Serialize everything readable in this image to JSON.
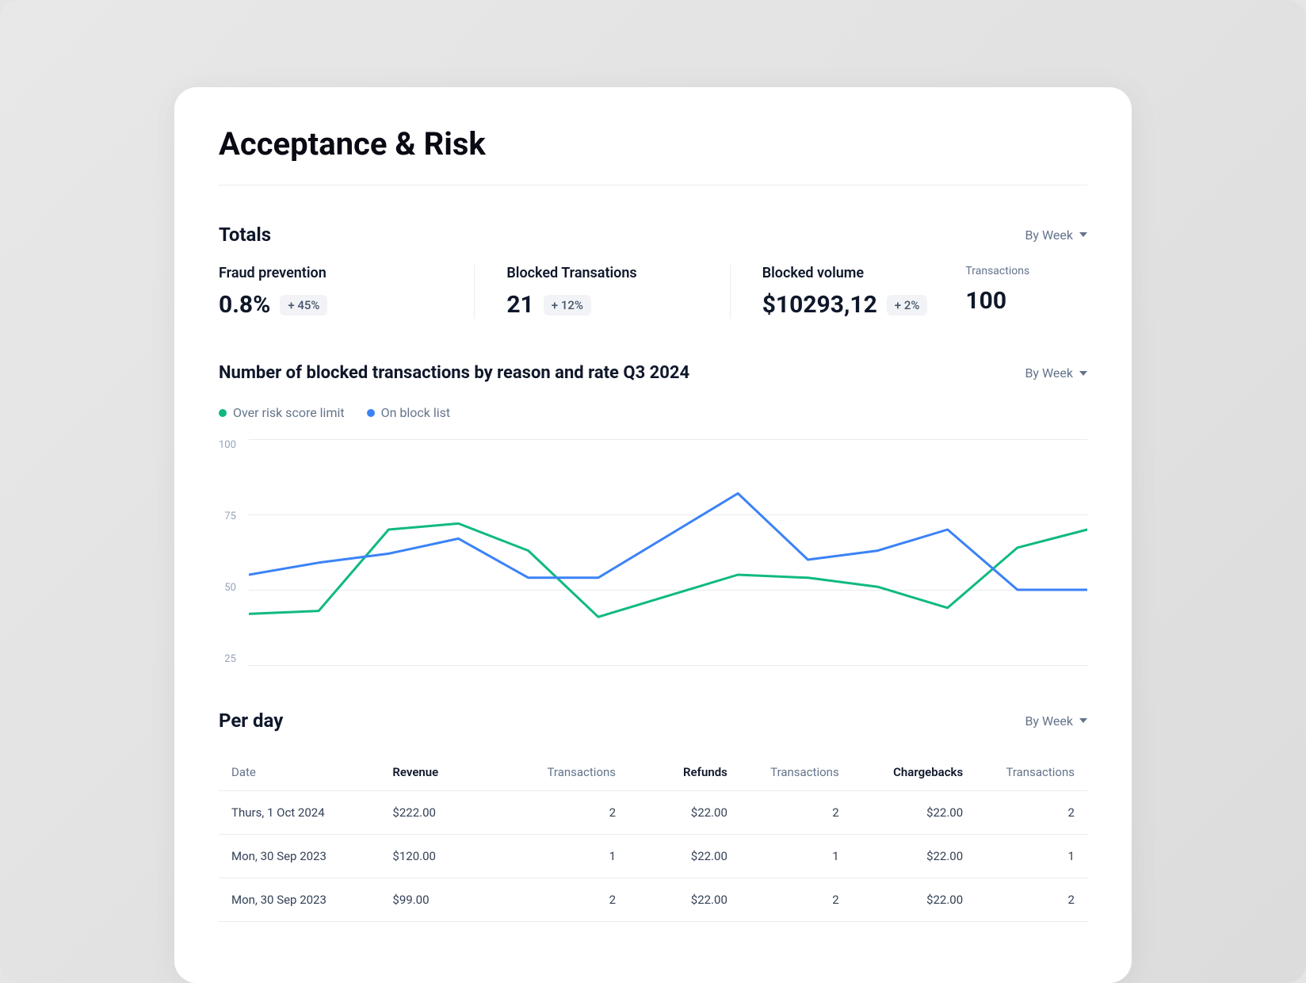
{
  "page": {
    "title": "Acceptance & Risk"
  },
  "totals": {
    "title": "Totals",
    "dropdown": "By Week",
    "fraud_prevention": {
      "label": "Fraud prevention",
      "value": "0.8%",
      "delta": "+ 45%"
    },
    "blocked_transactions": {
      "label": "Blocked Transations",
      "value": "21",
      "delta": "+ 12%"
    },
    "blocked_volume": {
      "label": "Blocked volume",
      "value": "$10293,12",
      "delta": "+ 2%"
    },
    "transactions": {
      "label": "Transactions",
      "value": "100"
    }
  },
  "chart": {
    "title": "Number of blocked transactions by reason and rate Q3 2024",
    "dropdown": "By Week",
    "legend": {
      "over_risk": "Over risk score limit",
      "on_block": "On block list"
    },
    "yticks": {
      "0": "100",
      "1": "75",
      "2": "50",
      "3": "25"
    }
  },
  "chart_data": {
    "type": "line",
    "title": "Number of blocked transactions by reason and rate Q3 2024",
    "ylabel": "",
    "xlabel": "",
    "ylim": [
      25,
      100
    ],
    "x": [
      0,
      1,
      2,
      3,
      4,
      5,
      6,
      7,
      8,
      9,
      10,
      11,
      12
    ],
    "series": [
      {
        "name": "Over risk score limit",
        "color": "#10b981",
        "values": [
          42,
          43,
          70,
          72,
          63,
          41,
          48,
          55,
          54,
          51,
          44,
          64,
          70
        ]
      },
      {
        "name": "On block list",
        "color": "#3b82f6",
        "values": [
          55,
          59,
          62,
          67,
          54,
          54,
          68,
          82,
          60,
          63,
          70,
          50,
          50
        ]
      }
    ]
  },
  "per_day": {
    "title": "Per day",
    "dropdown": "By Week",
    "columns": {
      "date": "Date",
      "revenue": "Revenue",
      "rev_tx": "Transactions",
      "refunds": "Refunds",
      "ref_tx": "Transactions",
      "chargebacks": "Chargebacks",
      "cb_tx": "Transactions"
    },
    "rows": [
      {
        "date": "Thurs, 1 Oct 2024",
        "revenue": "$222.00",
        "rev_tx": "2",
        "refunds": "$22.00",
        "ref_tx": "2",
        "chargebacks": "$22.00",
        "cb_tx": "2"
      },
      {
        "date": "Mon, 30 Sep 2023",
        "revenue": "$120.00",
        "rev_tx": "1",
        "refunds": "$22.00",
        "ref_tx": "1",
        "chargebacks": "$22.00",
        "cb_tx": "1"
      },
      {
        "date": "Mon, 30 Sep 2023",
        "revenue": "$99.00",
        "rev_tx": "2",
        "refunds": "$22.00",
        "ref_tx": "2",
        "chargebacks": "$22.00",
        "cb_tx": "2"
      }
    ]
  }
}
